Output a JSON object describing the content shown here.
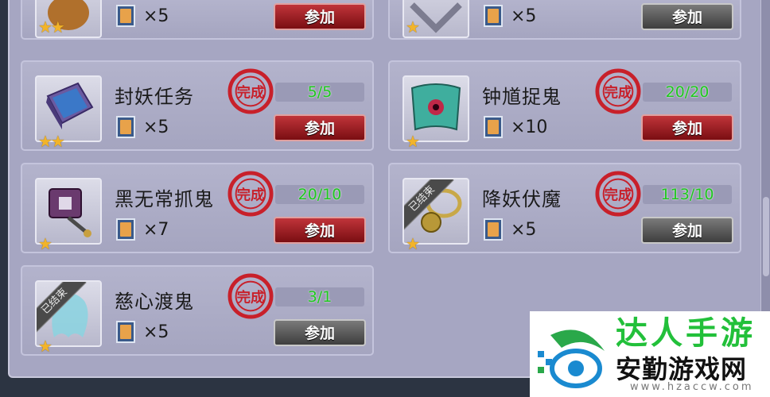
{
  "badge_complete": "完成",
  "ended_ribbon": "已结束",
  "tasks": [
    {
      "name": "",
      "progress": "",
      "reward_count": "×5",
      "button": "参加",
      "button_style": "red",
      "stars": "★★",
      "ended": false,
      "completed": false,
      "icon": "bag-icon"
    },
    {
      "name": "",
      "progress": "",
      "reward_count": "×5",
      "button": "参加",
      "button_style": "gray",
      "stars": "★",
      "ended": false,
      "completed": false,
      "icon": "amulet-icon"
    },
    {
      "name": "封妖任务",
      "progress": "5/5",
      "reward_count": "×5",
      "button": "参加",
      "button_style": "red",
      "stars": "★★",
      "ended": false,
      "completed": true,
      "icon": "book-icon"
    },
    {
      "name": "钟馗捉鬼",
      "progress": "20/20",
      "reward_count": "×10",
      "button": "参加",
      "button_style": "red",
      "stars": "★",
      "ended": false,
      "completed": true,
      "icon": "scroll-icon"
    },
    {
      "name": "黑无常抓鬼",
      "progress": "20/10",
      "reward_count": "×7",
      "button": "参加",
      "button_style": "red",
      "stars": "★",
      "ended": false,
      "completed": true,
      "icon": "token-icon"
    },
    {
      "name": "降妖伏魔",
      "progress": "113/10",
      "reward_count": "×5",
      "button": "参加",
      "button_style": "gray",
      "stars": "★",
      "ended": true,
      "completed": true,
      "icon": "bell-icon"
    },
    {
      "name": "慈心渡鬼",
      "progress": "3/1",
      "reward_count": "×5",
      "button": "参加",
      "button_style": "gray",
      "stars": "★",
      "ended": true,
      "completed": true,
      "icon": "ghost-icon"
    }
  ],
  "watermark": {
    "top_text": "达人手游",
    "main_text": "安勤游戏网",
    "url": "www.hzaccw.com"
  },
  "colors": {
    "progress_text": "#1ec81e",
    "seal": "#c8202a",
    "button_red": "#a01e24",
    "button_gray": "#555555",
    "watermark_green": "#22c03a"
  }
}
